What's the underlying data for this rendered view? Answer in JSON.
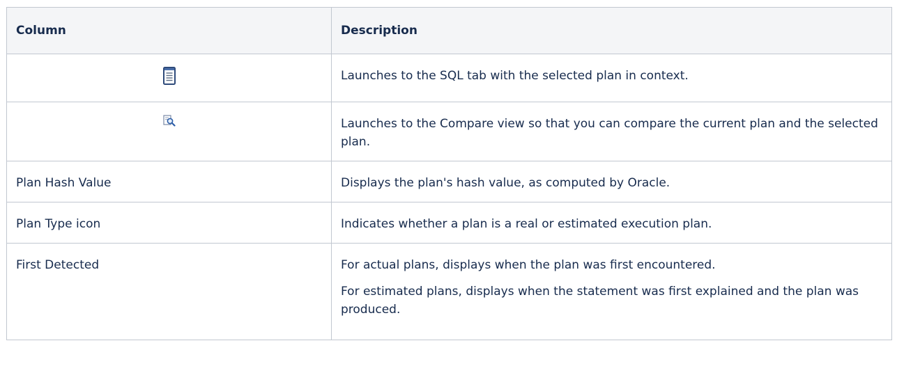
{
  "table": {
    "headers": {
      "column": "Column",
      "description": "Description"
    },
    "rows": [
      {
        "column_icon": "sql-document-icon",
        "description": [
          "Launches to the SQL tab with the selected plan in context."
        ]
      },
      {
        "column_icon": "compare-magnifier-icon",
        "description": [
          "Launches to the Compare view so that you can compare the current plan and the selected plan."
        ]
      },
      {
        "column": "Plan Hash Value",
        "description": [
          "Displays the plan's hash value, as computed by Oracle."
        ]
      },
      {
        "column": "Plan Type icon",
        "description": [
          "Indicates whether a plan is a real or estimated execution plan."
        ]
      },
      {
        "column": "First Detected",
        "description": [
          "For actual plans, displays when the plan was first encountered.",
          "For estimated plans, displays when the statement was first explained and the plan was produced."
        ]
      }
    ]
  }
}
